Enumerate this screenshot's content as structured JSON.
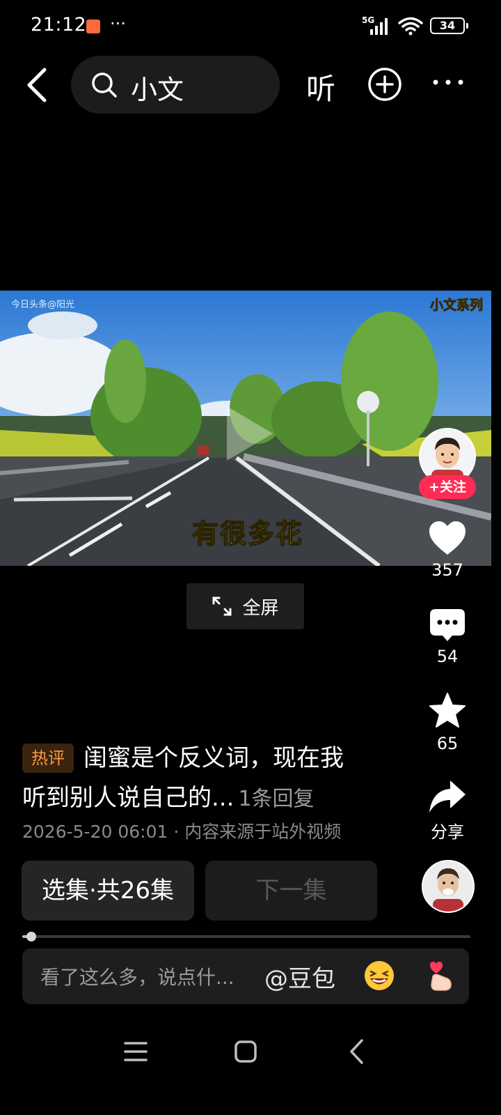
{
  "status_bar": {
    "time": "21:12",
    "dots": "···",
    "network": "5G",
    "battery": "34"
  },
  "top_bar": {
    "search_query": "小文",
    "listen_label": "听"
  },
  "video": {
    "watermark": "今日头条@阳光",
    "series_badge": "小文系列",
    "caption": "有很多花",
    "fullscreen_label": "全屏"
  },
  "creator": {
    "follow_label": "+关注"
  },
  "actions": {
    "likes": "357",
    "comments": "54",
    "favorites": "65",
    "share_label": "分享"
  },
  "hot_comment": {
    "badge": "热评",
    "line1": "闺蜜是个反义词，现在我",
    "line2": "听到别人说自己的...",
    "reply_count": "1条回复"
  },
  "meta": {
    "date": "2026-5-20 06:01",
    "source": "内容来源于站外视频"
  },
  "episodes": {
    "select_label": "选集·共26集",
    "next_label": "下一集"
  },
  "progress": {
    "fraction": 0.02
  },
  "comment_input": {
    "placeholder": "看了这么多，说点什...",
    "mention": "@豆包"
  },
  "icons": [
    "back-icon",
    "search-icon",
    "plus-circle-icon",
    "more-icon",
    "play-icon",
    "expand-icon",
    "heart-icon",
    "comment-icon",
    "star-icon",
    "share-icon",
    "laugh-emoji-icon",
    "finger-heart-icon",
    "menu-icon",
    "home-icon",
    "nav-back-icon"
  ],
  "colors": {
    "accent": "#fe2c55",
    "hot_badge": "#ff9a3c",
    "caption": "#f7d64a"
  }
}
